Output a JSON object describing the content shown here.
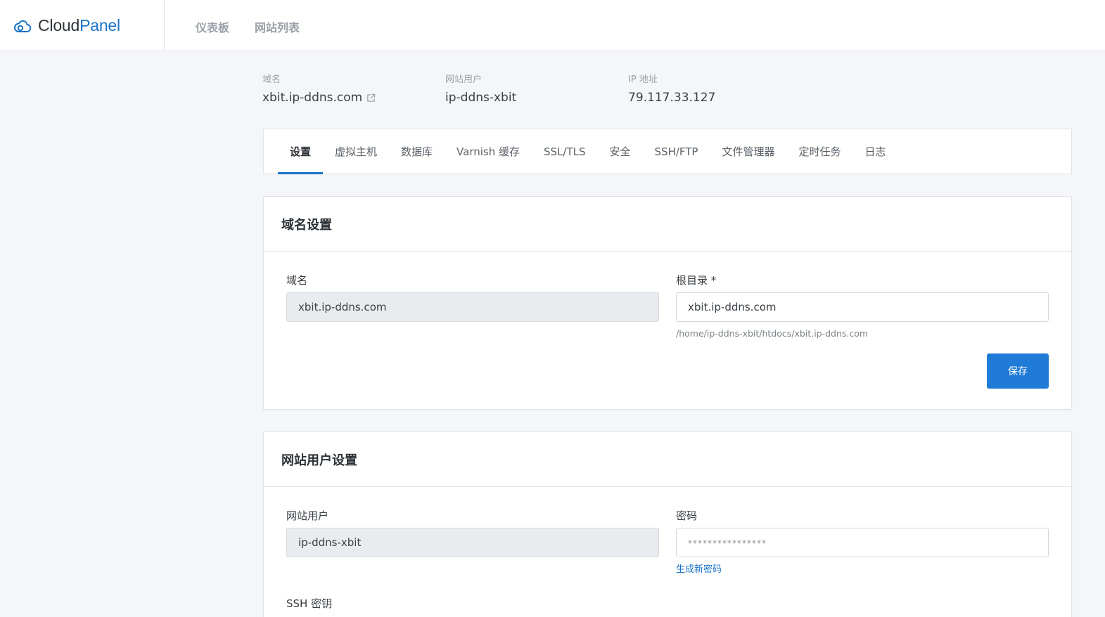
{
  "brand": {
    "name_part1": "Cloud",
    "name_part2": "Panel"
  },
  "topnav": {
    "dashboard": "仪表板",
    "sites": "网站列表"
  },
  "meta": {
    "domain_label": "域名",
    "domain_value": "xbit.ip-ddns.com",
    "user_label": "网站用户",
    "user_value": "ip-ddns-xbit",
    "ip_label": "IP 地址",
    "ip_value": "79.117.33.127"
  },
  "tabs": [
    {
      "label": "设置",
      "active": true
    },
    {
      "label": "虚拟主机"
    },
    {
      "label": "数据库"
    },
    {
      "label": "Varnish 缓存"
    },
    {
      "label": "SSL/TLS"
    },
    {
      "label": "安全"
    },
    {
      "label": "SSH/FTP"
    },
    {
      "label": "文件管理器"
    },
    {
      "label": "定时任务"
    },
    {
      "label": "日志"
    }
  ],
  "domain_settings": {
    "title": "域名设置",
    "domain_label": "域名",
    "domain_value": "xbit.ip-ddns.com",
    "root_label": "根目录 *",
    "root_value": "xbit.ip-ddns.com",
    "root_hint": "/home/ip-ddns-xbit/htdocs/xbit.ip-ddns.com",
    "save_label": "保存"
  },
  "user_settings": {
    "title": "网站用户设置",
    "user_label": "网站用户",
    "user_value": "ip-ddns-xbit",
    "password_label": "密码",
    "password_placeholder": "****************",
    "generate_label": "生成新密码",
    "ssh_key_label": "SSH 密钥"
  },
  "colors": {
    "accent": "#1a73c9",
    "button": "#1f7bd6",
    "background": "#f4f6f9"
  }
}
